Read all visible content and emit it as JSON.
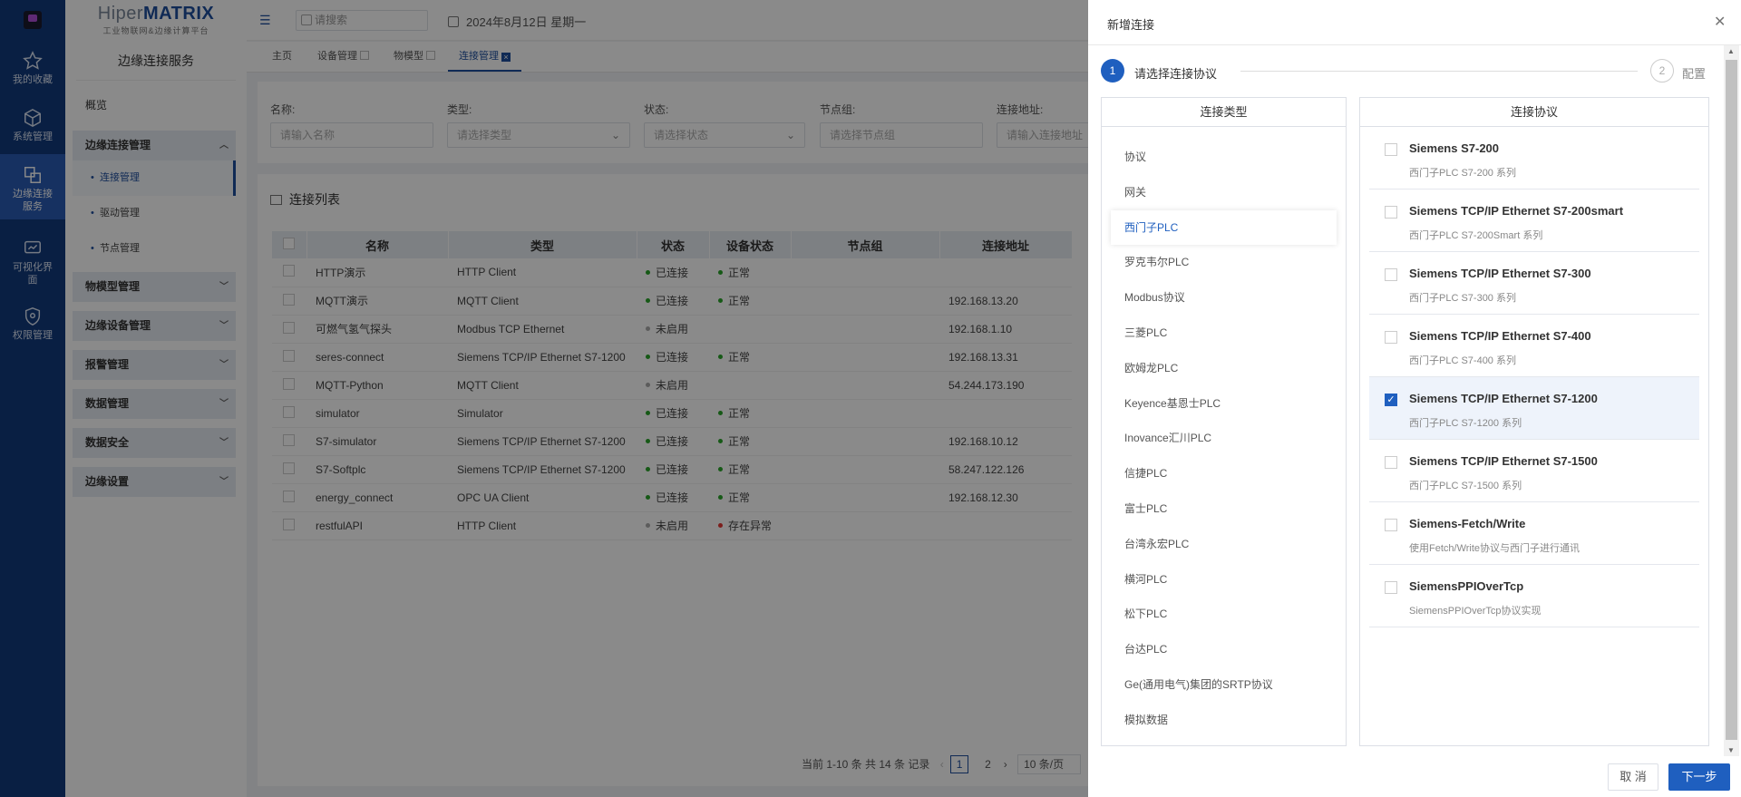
{
  "rail": {
    "items": [
      {
        "label": "我的收藏",
        "icon": "star-icon"
      },
      {
        "label": "系统管理",
        "icon": "cube-icon"
      },
      {
        "label": "边缘连接服务",
        "icon": "connect-icon"
      },
      {
        "label": "可视化界面",
        "icon": "monitor-icon"
      },
      {
        "label": "权限管理",
        "icon": "shield-icon"
      }
    ]
  },
  "brand": {
    "title_a": "Hiper",
    "title_b": "MATRIX",
    "subtitle": "工业物联网&边缘计算平台"
  },
  "menu": {
    "header": "边缘连接服务",
    "overview": "概览",
    "group_open": "边缘连接管理",
    "subs": [
      "连接管理",
      "驱动管理",
      "节点管理"
    ],
    "groups": [
      "物模型管理",
      "边缘设备管理",
      "报警管理",
      "数据管理",
      "数据安全",
      "边缘设置"
    ]
  },
  "topbar": {
    "search_placeholder": "请搜索",
    "date": "2024年8月12日 星期一"
  },
  "tabs": [
    "主页",
    "设备管理",
    "物模型",
    "连接管理"
  ],
  "filters": [
    {
      "label": "名称:",
      "placeholder": "请输入名称"
    },
    {
      "label": "类型:",
      "placeholder": "请选择类型"
    },
    {
      "label": "状态:",
      "placeholder": "请选择状态"
    },
    {
      "label": "节点组:",
      "placeholder": "请选择节点组"
    },
    {
      "label": "连接地址:",
      "placeholder": "请输入连接地址"
    }
  ],
  "list": {
    "title": "连接列表",
    "columns": [
      "名称",
      "类型",
      "状态",
      "设备状态",
      "节点组",
      "连接地址"
    ],
    "rows": [
      {
        "name": "HTTP演示",
        "type": "HTTP Client",
        "status": "已连接",
        "dev": "正常",
        "group": "",
        "addr": ""
      },
      {
        "name": "MQTT演示",
        "type": "MQTT Client",
        "status": "已连接",
        "dev": "正常",
        "group": "",
        "addr": "192.168.13.20"
      },
      {
        "name": "可燃气氢气探头",
        "type": "Modbus TCP Ethernet",
        "status": "未启用",
        "dev": "",
        "group": "",
        "addr": "192.168.1.10"
      },
      {
        "name": "seres-connect",
        "type": "Siemens TCP/IP Ethernet S7-1200",
        "status": "已连接",
        "dev": "正常",
        "group": "",
        "addr": "192.168.13.31"
      },
      {
        "name": "MQTT-Python",
        "type": "MQTT Client",
        "status": "未启用",
        "dev": "",
        "group": "",
        "addr": "54.244.173.190"
      },
      {
        "name": "simulator",
        "type": "Simulator",
        "status": "已连接",
        "dev": "正常",
        "group": "",
        "addr": ""
      },
      {
        "name": "S7-simulator",
        "type": "Siemens TCP/IP Ethernet S7-1200",
        "status": "已连接",
        "dev": "正常",
        "group": "",
        "addr": "192.168.10.12"
      },
      {
        "name": "S7-Softplc",
        "type": "Siemens TCP/IP Ethernet S7-1200",
        "status": "已连接",
        "dev": "正常",
        "group": "",
        "addr": "58.247.122.126"
      },
      {
        "name": "energy_connect",
        "type": "OPC UA Client",
        "status": "已连接",
        "dev": "正常",
        "group": "",
        "addr": "192.168.12.30"
      },
      {
        "name": "restfulAPI",
        "type": "HTTP Client",
        "status": "未启用",
        "dev": "存在异常",
        "group": "",
        "addr": ""
      }
    ],
    "pager": {
      "summary": "当前 1-10 条 共 14 条 记录",
      "pages": [
        "1",
        "2"
      ],
      "size": "10 条/页"
    }
  },
  "colors": {
    "accent": "#1f5fbf",
    "ok": "#2aa52a",
    "off": "#aaaaaa",
    "err": "#e53935"
  },
  "drawer": {
    "title": "新增连接",
    "step1_num": "1",
    "step1_label": "请选择连接协议",
    "step2_num": "2",
    "step2_label": "配置",
    "left_header": "连接类型",
    "right_header": "连接协议",
    "categories": [
      "协议",
      "网关",
      "西门子PLC",
      "罗克韦尔PLC",
      "Modbus协议",
      "三菱PLC",
      "欧姆龙PLC",
      "Keyence基恩士PLC",
      "Inovance汇川PLC",
      "信捷PLC",
      "富士PLC",
      "台湾永宏PLC",
      "横河PLC",
      "松下PLC",
      "台达PLC",
      "Ge(通用电气)集团的SRTP协议",
      "模拟数据"
    ],
    "selected_category": "西门子PLC",
    "protocols": [
      {
        "name": "Siemens S7-200",
        "desc": "西门子PLC S7-200 系列",
        "checked": false
      },
      {
        "name": "Siemens TCP/IP Ethernet S7-200smart",
        "desc": "西门子PLC S7-200Smart 系列",
        "checked": false
      },
      {
        "name": "Siemens TCP/IP Ethernet S7-300",
        "desc": "西门子PLC S7-300 系列",
        "checked": false
      },
      {
        "name": "Siemens TCP/IP Ethernet S7-400",
        "desc": "西门子PLC S7-400 系列",
        "checked": false
      },
      {
        "name": "Siemens TCP/IP Ethernet S7-1200",
        "desc": "西门子PLC S7-1200 系列",
        "checked": true
      },
      {
        "name": "Siemens TCP/IP Ethernet S7-1500",
        "desc": "西门子PLC S7-1500 系列",
        "checked": false
      },
      {
        "name": "Siemens-Fetch/Write",
        "desc": "使用Fetch/Write协议与西门子进行通讯",
        "checked": false
      },
      {
        "name": "SiemensPPIOverTcp",
        "desc": "SiemensPPIOverTcp协议实现",
        "checked": false
      }
    ],
    "cancel": "取 消",
    "next": "下一步"
  }
}
